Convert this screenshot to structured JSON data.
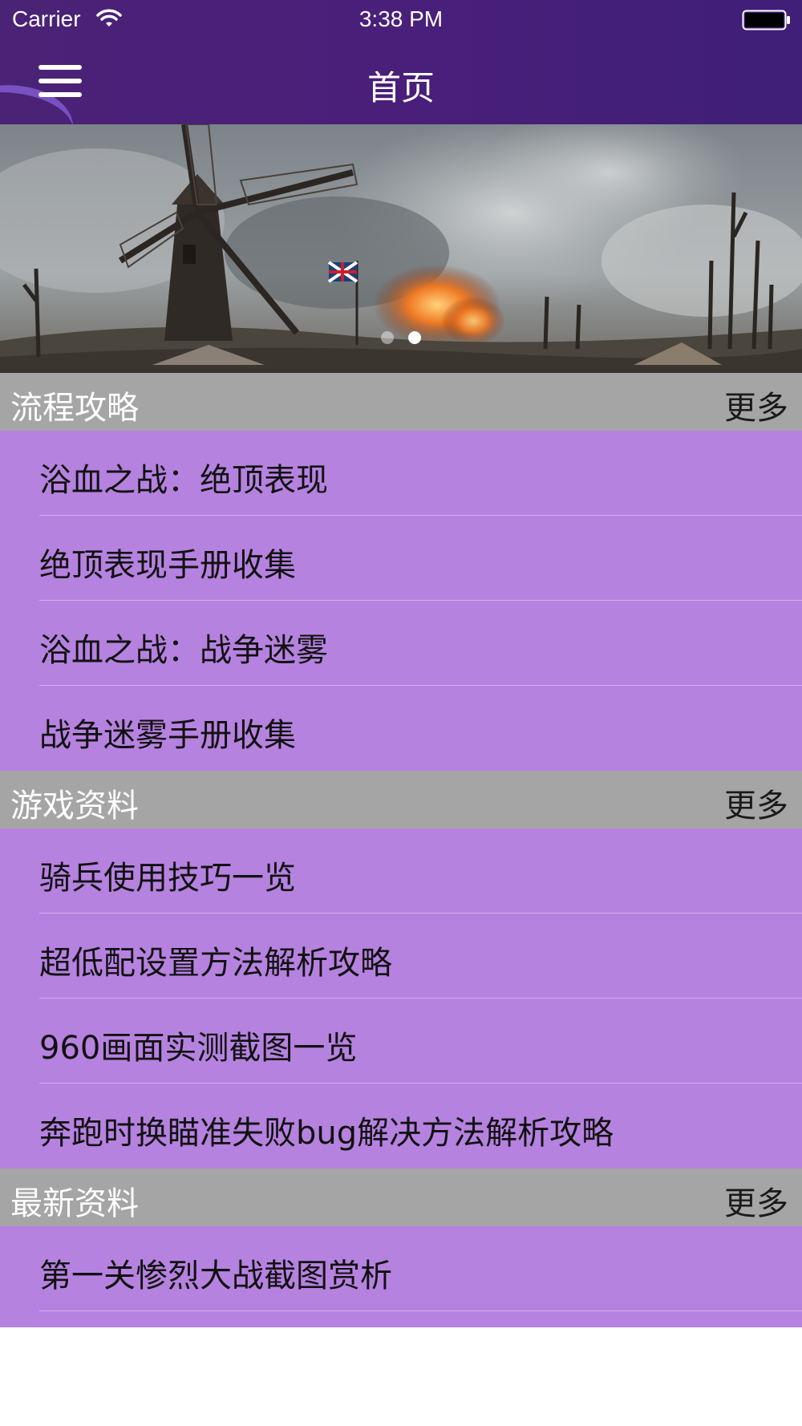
{
  "status_bar": {
    "carrier": "Carrier",
    "time": "3:38 PM"
  },
  "nav": {
    "title": "首页",
    "menu_icon": "hamburger-menu-icon"
  },
  "banner": {
    "description_icon": "banner-image",
    "page_count": 2,
    "active_page": 2
  },
  "sections": [
    {
      "title": "流程攻略",
      "more": "更多",
      "items": [
        "浴血之战：绝顶表现",
        "绝顶表现手册收集",
        "浴血之战：战争迷雾",
        "战争迷雾手册收集"
      ]
    },
    {
      "title": "游戏资料",
      "more": "更多",
      "items": [
        "骑兵使用技巧一览",
        "超低配设置方法解析攻略",
        "960画面实测截图一览",
        "奔跑时换瞄准失败bug解决方法解析攻略"
      ]
    },
    {
      "title": "最新资料",
      "more": "更多",
      "items": [
        "第一关惨烈大战截图赏析"
      ]
    }
  ],
  "colors": {
    "nav_background": "#4a2276",
    "section_header": "#a5a5a5",
    "list_background": "#b682e0"
  }
}
